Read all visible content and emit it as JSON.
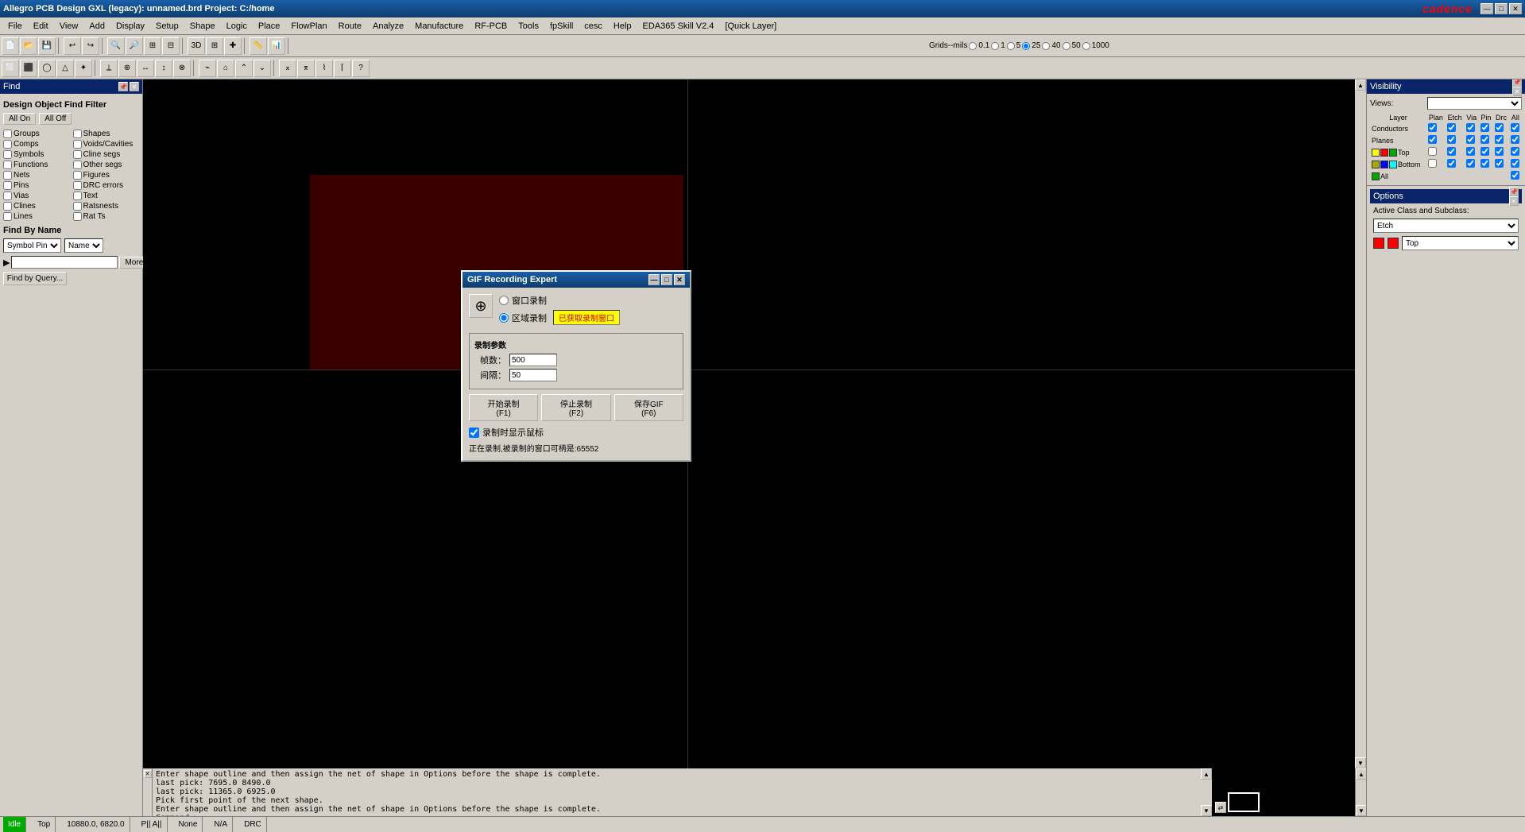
{
  "titleBar": {
    "title": "Allegro PCB Design GXL (legacy): unnamed.brd  Project: C:/home",
    "minimize": "—",
    "maximize": "□",
    "close": "✕"
  },
  "menuBar": {
    "items": [
      "File",
      "Edit",
      "View",
      "Add",
      "Display",
      "Setup",
      "Shape",
      "Logic",
      "Place",
      "FlowPlan",
      "Route",
      "Analyze",
      "Manufacture",
      "RF-PCB",
      "Tools",
      "fpSkill",
      "cesc",
      "Help",
      "EDA365 Skill V2.4",
      "[Quick Layer]"
    ]
  },
  "cadenceLogo": "cadence",
  "grids": {
    "label": "Grids--mils",
    "options": [
      "0.1",
      "1",
      "5",
      "25",
      "40",
      "50",
      "1000"
    ]
  },
  "findPanel": {
    "title": "Find",
    "allOn": "All On",
    "allOff": "All Off",
    "sectionTitle": "Design Object Find Filter",
    "checkboxes": [
      {
        "label": "Groups",
        "checked": false
      },
      {
        "label": "Shapes",
        "checked": false
      },
      {
        "label": "Comps",
        "checked": false
      },
      {
        "label": "Voids/Cavities",
        "checked": false
      },
      {
        "label": "Symbols",
        "checked": false
      },
      {
        "label": "Cline segs",
        "checked": false
      },
      {
        "label": "Functions",
        "checked": false
      },
      {
        "label": "Other segs",
        "checked": false
      },
      {
        "label": "Nets",
        "checked": false
      },
      {
        "label": "Figures",
        "checked": false
      },
      {
        "label": "Pins",
        "checked": false
      },
      {
        "label": "DRC errors",
        "checked": false
      },
      {
        "label": "Vias",
        "checked": false
      },
      {
        "label": "Text",
        "checked": false
      },
      {
        "label": "Clines",
        "checked": false
      },
      {
        "label": "Ratsnests",
        "checked": false
      },
      {
        "label": "Lines",
        "checked": false
      },
      {
        "label": "Rat Ts",
        "checked": false
      }
    ],
    "findByName": "Find By Name",
    "symbolPin": "Symbol Pin",
    "name": "Name",
    "moreBtn": "More",
    "findQueryBtn": "Find by Query..."
  },
  "gifDialog": {
    "title": "GIF Recording Expert",
    "radio1": "窗口录制",
    "radio2": "区域录制",
    "yellowBtnText": "已获取录制窗口",
    "params": {
      "title": "录制参数",
      "framesLabel": "帧数：",
      "framesValue": "500",
      "intervalLabel": "间隔：",
      "intervalValue": "50"
    },
    "btn1": "开始录制\n(F1)",
    "btn2": "停止录制\n(F2)",
    "btn3": "保存GIF\n(F6)",
    "checkboxLabel": "录制时显示鼠标",
    "statusText": "正在录制,被录制的窗口可柄是:65552",
    "btnMin": "—",
    "btnMax": "□",
    "btnClose": "✕"
  },
  "visibility": {
    "title": "Visibility",
    "viewsLabel": "Views:",
    "viewsValue": "",
    "tableHeaders": [
      "Layer",
      "Plan",
      "Etch",
      "Via",
      "Pin",
      "Drc",
      "All"
    ],
    "rows": [
      {
        "label": "Conductors",
        "plan": true,
        "etch": true,
        "via": true,
        "pin": true,
        "drc": true,
        "all": true,
        "colors": []
      },
      {
        "label": "Planes",
        "plan": true,
        "etch": true,
        "via": true,
        "pin": true,
        "drc": true,
        "all": true,
        "colors": []
      },
      {
        "label": "Top",
        "plan": false,
        "etch": true,
        "via": true,
        "pin": true,
        "drc": true,
        "all": true,
        "colors": [
          "#ffff00",
          "#ff0000",
          "#00aa00",
          "#aaaaaa",
          "#ffffff"
        ]
      },
      {
        "label": "Bottom",
        "plan": false,
        "etch": true,
        "via": true,
        "pin": true,
        "drc": true,
        "all": true,
        "colors": [
          "#aaaa00",
          "#0000ff",
          "#00ffff",
          "#888888",
          "#ffffff"
        ]
      },
      {
        "label": "All",
        "plan": false,
        "etch": false,
        "via": false,
        "pin": false,
        "drc": false,
        "all": true,
        "colors": [
          "#00aa00"
        ]
      }
    ]
  },
  "options": {
    "title": "Options",
    "activeClassLabel": "Active Class and Subclass:",
    "classValue": "Etch",
    "subclassValue": "Top",
    "color1": "#ff0000",
    "color2": "#ff0000"
  },
  "console": {
    "lines": [
      "Enter shape outline and then assign the net of shape in Options before the shape is complete.",
      "last pick:  7695.0 8490.0",
      "last pick:  11365.0 6925.0",
      "Pick first point of the next shape.",
      "Enter shape outline and then assign the net of shape in Options before the shape is complete.",
      "Command >"
    ]
  },
  "statusBar": {
    "idle": "Idle",
    "status": "Idle",
    "layer": "Top",
    "coords": "10880.0, 6820.0",
    "pins": "P|| A||",
    "none": "None",
    "na": "N/A",
    "drc": "DRC"
  }
}
